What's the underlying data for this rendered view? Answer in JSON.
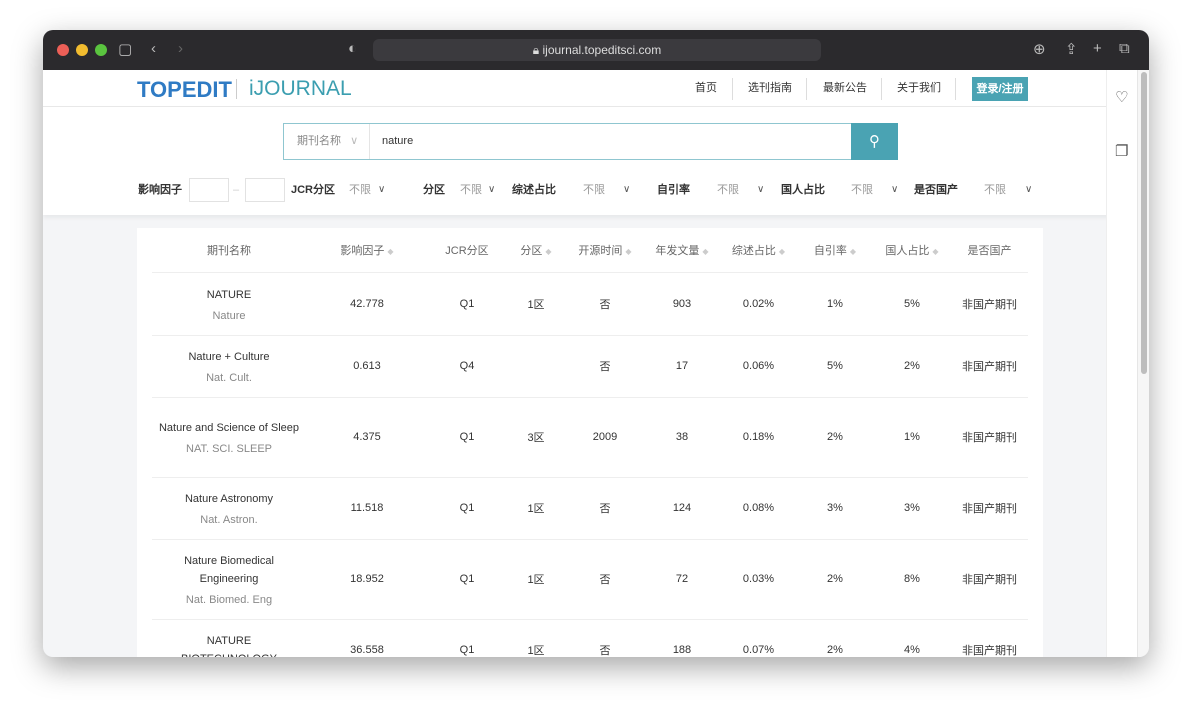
{
  "browser": {
    "url": "ijournal.topeditsci.com"
  },
  "nav": {
    "logo_main": "TOPEDIT",
    "logo_sub": "iJOURNAL",
    "items": [
      "首页",
      "选刊指南",
      "最新公告",
      "关于我们"
    ],
    "login": "登录/注册"
  },
  "search": {
    "field": "期刊名称",
    "value": "nature"
  },
  "filters": {
    "if_label": "影响因子",
    "dash": "–",
    "items": [
      {
        "label": "JCR分区",
        "value": "不限"
      },
      {
        "label": "分区",
        "value": "不限"
      },
      {
        "label": "综述占比",
        "value": "不限"
      },
      {
        "label": "自引率",
        "value": "不限"
      },
      {
        "label": "国人占比",
        "value": "不限"
      },
      {
        "label": "是否国产",
        "value": "不限"
      }
    ]
  },
  "table": {
    "headers": [
      "期刊名称",
      "影响因子",
      "JCR分区",
      "分区",
      "开源时间",
      "年发文量",
      "综述占比",
      "自引率",
      "国人占比",
      "是否国产"
    ],
    "rows": [
      {
        "name": "NATURE",
        "abbr": "Nature",
        "if": "42.778",
        "jcr": "Q1",
        "zone": "1区",
        "oa": "否",
        "count": "903",
        "review": "0.02%",
        "self": "1%",
        "cn": "5%",
        "domestic": "非国产期刊"
      },
      {
        "name": "Nature + Culture",
        "abbr": "Nat. Cult.",
        "if": "0.613",
        "jcr": "Q4",
        "zone": "",
        "oa": "否",
        "count": "17",
        "review": "0.06%",
        "self": "5%",
        "cn": "2%",
        "domestic": "非国产期刊"
      },
      {
        "name": "Nature and Science of Sleep",
        "abbr": "NAT. SCI. SLEEP",
        "if": "4.375",
        "jcr": "Q1",
        "zone": "3区",
        "oa": "2009",
        "count": "38",
        "review": "0.18%",
        "self": "2%",
        "cn": "1%",
        "domestic": "非国产期刊"
      },
      {
        "name": "Nature Astronomy",
        "abbr": "Nat. Astron.",
        "if": "11.518",
        "jcr": "Q1",
        "zone": "1区",
        "oa": "否",
        "count": "124",
        "review": "0.08%",
        "self": "3%",
        "cn": "3%",
        "domestic": "非国产期刊"
      },
      {
        "name": "Nature Biomedical Engineering",
        "abbr": "Nat. Biomed. Eng",
        "if": "18.952",
        "jcr": "Q1",
        "zone": "1区",
        "oa": "否",
        "count": "72",
        "review": "0.03%",
        "self": "2%",
        "cn": "8%",
        "domestic": "非国产期刊"
      },
      {
        "name": "NATURE BIOTECHNOLOGY",
        "abbr": "",
        "if": "36.558",
        "jcr": "Q1",
        "zone": "1区",
        "oa": "否",
        "count": "188",
        "review": "0.07%",
        "self": "2%",
        "cn": "4%",
        "domestic": "非国产期刊"
      }
    ]
  }
}
